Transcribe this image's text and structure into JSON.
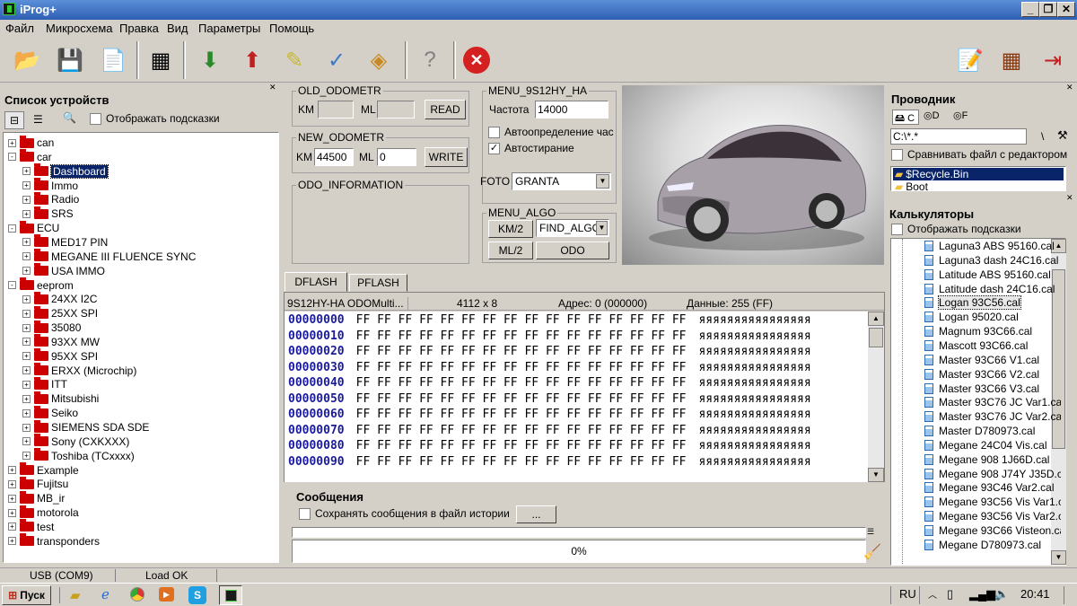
{
  "window": {
    "title": "iProg+"
  },
  "menu": [
    "Файл",
    "Микросхема",
    "Правка",
    "Вид",
    "Параметры",
    "Помощь"
  ],
  "devices": {
    "title": "Список устройств",
    "hints": "Отображать подсказки",
    "tree": [
      {
        "label": "can",
        "lvl": 0,
        "exp": "+"
      },
      {
        "label": "car",
        "lvl": 0,
        "exp": "-"
      },
      {
        "label": "Dashboard",
        "lvl": 1,
        "exp": "+",
        "sel": true
      },
      {
        "label": "Immo",
        "lvl": 1,
        "exp": "+"
      },
      {
        "label": "Radio",
        "lvl": 1,
        "exp": "+"
      },
      {
        "label": "SRS",
        "lvl": 1,
        "exp": "+"
      },
      {
        "label": "ECU",
        "lvl": 0,
        "exp": "-"
      },
      {
        "label": "MED17 PIN",
        "lvl": 1,
        "exp": "+"
      },
      {
        "label": "MEGANE III FLUENCE SYNC",
        "lvl": 1,
        "exp": "+"
      },
      {
        "label": "USA IMMO",
        "lvl": 1,
        "exp": "+"
      },
      {
        "label": "eeprom",
        "lvl": 0,
        "exp": "-"
      },
      {
        "label": "24XX I2C",
        "lvl": 1,
        "exp": "+"
      },
      {
        "label": "25XX SPI",
        "lvl": 1,
        "exp": "+"
      },
      {
        "label": "35080",
        "lvl": 1,
        "exp": "+"
      },
      {
        "label": "93XX MW",
        "lvl": 1,
        "exp": "+"
      },
      {
        "label": "95XX SPI",
        "lvl": 1,
        "exp": "+"
      },
      {
        "label": "ERXX (Microchip)",
        "lvl": 1,
        "exp": "+"
      },
      {
        "label": "ITT",
        "lvl": 1,
        "exp": "+"
      },
      {
        "label": "Mitsubishi",
        "lvl": 1,
        "exp": "+"
      },
      {
        "label": "Seiko",
        "lvl": 1,
        "exp": "+"
      },
      {
        "label": "SIEMENS SDA SDE",
        "lvl": 1,
        "exp": "+"
      },
      {
        "label": "Sony (CXKXXX)",
        "lvl": 1,
        "exp": "+"
      },
      {
        "label": "Toshiba (TCxxxx)",
        "lvl": 1,
        "exp": "+"
      },
      {
        "label": "Example",
        "lvl": 0,
        "exp": "+"
      },
      {
        "label": "Fujitsu",
        "lvl": 0,
        "exp": "+"
      },
      {
        "label": "MB_ir",
        "lvl": 0,
        "exp": "+"
      },
      {
        "label": "motorola",
        "lvl": 0,
        "exp": "+"
      },
      {
        "label": "test",
        "lvl": 0,
        "exp": "+"
      },
      {
        "label": "transponders",
        "lvl": 0,
        "exp": "+"
      }
    ]
  },
  "old_odo": {
    "legend": "OLD_ODOMETR",
    "km": "KM",
    "ml": "ML",
    "read": "READ"
  },
  "new_odo": {
    "legend": "NEW_ODOMETR",
    "km": "KM",
    "km_val": "44500",
    "ml": "ML",
    "ml_val": "0",
    "write": "WRITE"
  },
  "odo_info": {
    "legend": "ODO_INFORMATION"
  },
  "menu_chip": {
    "legend": "MENU_9S12HY_HA",
    "freq_label": "Частота",
    "freq_val": "14000",
    "autodetect": "Автоопределение час",
    "autoerase": "Автостирание"
  },
  "foto": {
    "label": "FOTO",
    "value": "GRANTA"
  },
  "algo": {
    "legend": "MENU_ALGO",
    "km2": "KM/2",
    "ml2": "ML/2",
    "select": "FIND_ALGO",
    "odo": "ODO"
  },
  "tabs": [
    "DFLASH",
    "PFLASH"
  ],
  "hex": {
    "info": [
      "9S12HY-HA ODOMulti...",
      "4112 x 8",
      "Адрес: 0 (000000)",
      "Данные: 255 (FF)"
    ],
    "rows": [
      {
        "a": "00000000",
        "b": "FF FF FF FF FF FF FF FF FF FF FF FF FF FF FF FF",
        "t": "яяяяяяяяяяяяяяяя"
      },
      {
        "a": "00000010",
        "b": "FF FF FF FF FF FF FF FF FF FF FF FF FF FF FF FF",
        "t": "яяяяяяяяяяяяяяяя"
      },
      {
        "a": "00000020",
        "b": "FF FF FF FF FF FF FF FF FF FF FF FF FF FF FF FF",
        "t": "яяяяяяяяяяяяяяяя"
      },
      {
        "a": "00000030",
        "b": "FF FF FF FF FF FF FF FF FF FF FF FF FF FF FF FF",
        "t": "яяяяяяяяяяяяяяяя"
      },
      {
        "a": "00000040",
        "b": "FF FF FF FF FF FF FF FF FF FF FF FF FF FF FF FF",
        "t": "яяяяяяяяяяяяяяяя"
      },
      {
        "a": "00000050",
        "b": "FF FF FF FF FF FF FF FF FF FF FF FF FF FF FF FF",
        "t": "яяяяяяяяяяяяяяяя"
      },
      {
        "a": "00000060",
        "b": "FF FF FF FF FF FF FF FF FF FF FF FF FF FF FF FF",
        "t": "яяяяяяяяяяяяяяяя"
      },
      {
        "a": "00000070",
        "b": "FF FF FF FF FF FF FF FF FF FF FF FF FF FF FF FF",
        "t": "яяяяяяяяяяяяяяяя"
      },
      {
        "a": "00000080",
        "b": "FF FF FF FF FF FF FF FF FF FF FF FF FF FF FF FF",
        "t": "яяяяяяяяяяяяяяяя"
      },
      {
        "a": "00000090",
        "b": "FF FF FF FF FF FF FF FF FF FF FF FF FF FF FF FF",
        "t": "яяяяяяяяяяяяяяяя"
      }
    ]
  },
  "messages": {
    "title": "Сообщения",
    "save": "Сохранять сообщения в файл истории",
    "browse": "...",
    "progress": "0%"
  },
  "explorer": {
    "title": "Проводник",
    "drives": [
      "C",
      "D",
      "F"
    ],
    "path": "C:\\*.*",
    "sep": "\\",
    "compare": "Сравнивать файл с редактором",
    "items": [
      "$Recycle.Bin",
      "Boot"
    ]
  },
  "calc": {
    "title": "Калькуляторы",
    "hints": "Отображать подсказки",
    "files": [
      "Laguna3 ABS 95160.cal",
      "Laguna3 dash 24C16.cal",
      "Latitude ABS 95160.cal",
      "Latitude dash 24C16.cal",
      "Logan 93C56.cal",
      "Logan 95020.cal",
      "Magnum 93C66.cal",
      "Mascott 93C66.cal",
      "Master 93C66 V1.cal",
      "Master 93C66 V2.cal",
      "Master 93C66 V3.cal",
      "Master 93C76 JC Var1.cal",
      "Master 93C76 JC Var2.cal",
      "Master D780973.cal",
      "Megane 24C04 Vis.cal",
      "Megane 908 1J66D.cal",
      "Megane 908 J74Y J35D.ca",
      "Megane 93C46 Var2.cal",
      "Megane 93C56 Vis Var1.ca",
      "Megane 93C56 Vis Var2.ca",
      "Megane 93C66 Visteon.ca",
      "Megane D780973.cal"
    ],
    "selected": "Logan 93C56.cal"
  },
  "status": [
    "USB (COM9)",
    "Load OK"
  ],
  "taskbar": {
    "start": "Пуск",
    "lang": "RU",
    "time": "20:41"
  }
}
